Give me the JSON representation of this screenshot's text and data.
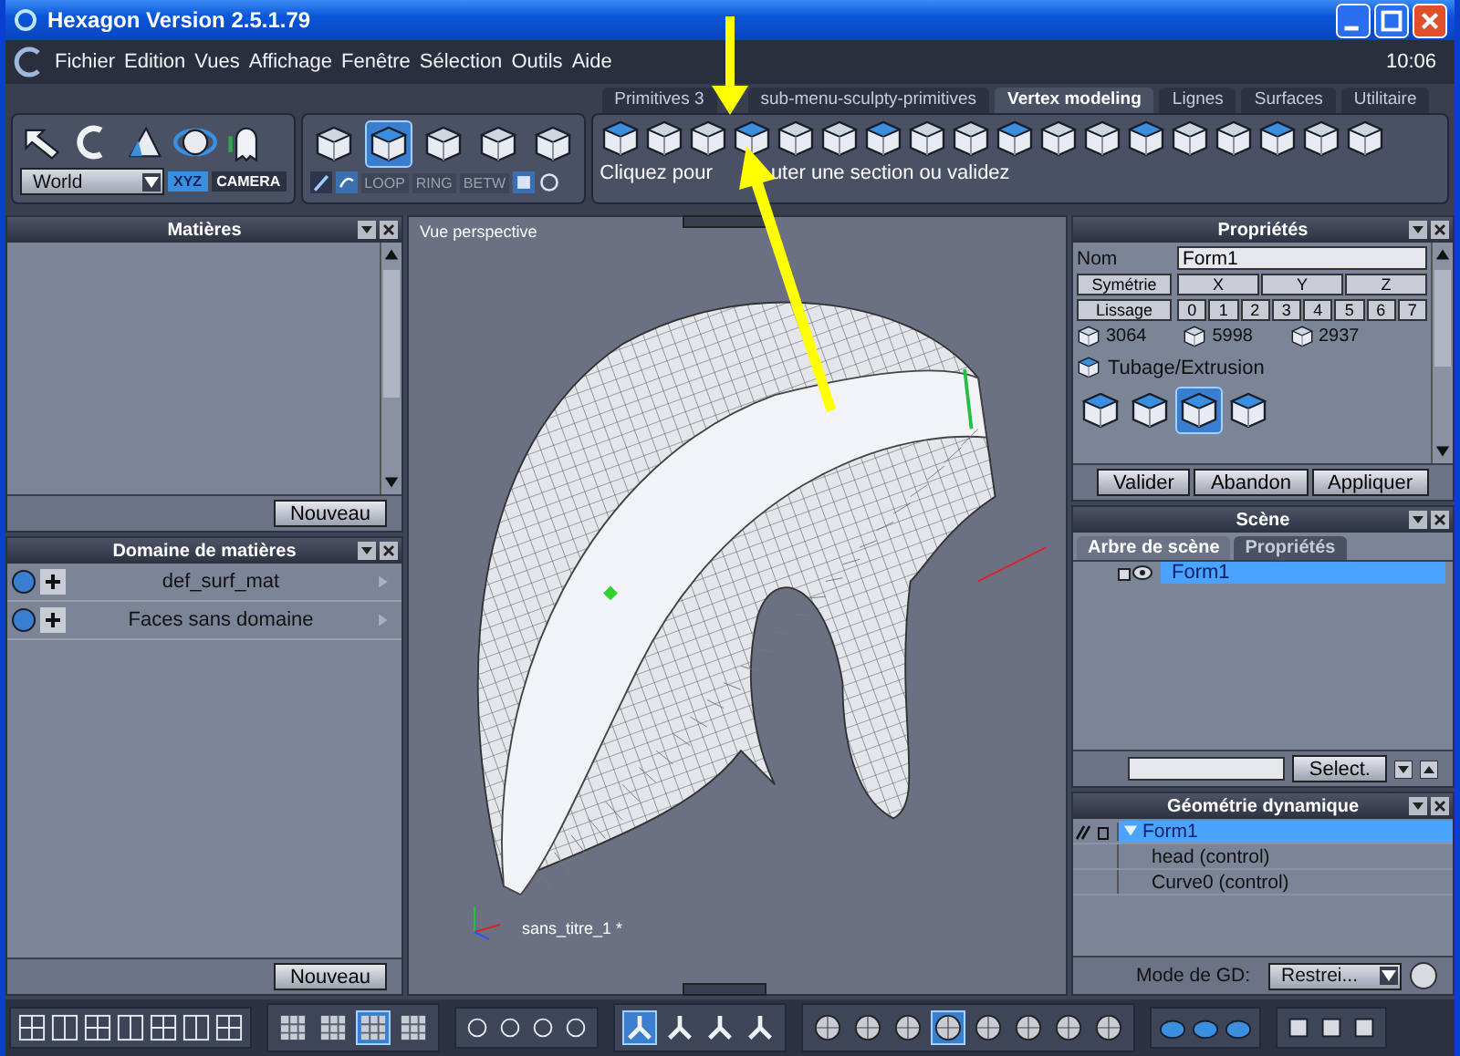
{
  "window": {
    "title": "Hexagon Version 2.5.1.79"
  },
  "menu": [
    "Fichier",
    "Edition",
    "Vues",
    "Affichage",
    "Fenêtre",
    "Sélection",
    "Outils",
    "Aide"
  ],
  "clock": "10:06",
  "coordinate_toolbar": {
    "space": "World",
    "toggles": [
      {
        "label": "XYZ",
        "selected": true
      },
      {
        "label": "CAMERA",
        "selected": false
      }
    ]
  },
  "selection_toolbar": {
    "modes": [
      {
        "selected": false
      },
      {
        "selected": true
      },
      {
        "selected": false
      },
      {
        "selected": false
      },
      {
        "selected": false
      }
    ],
    "options": [
      "LOOP",
      "RING",
      "BETW"
    ]
  },
  "tool_tabs": [
    {
      "label": "Primitives 3",
      "selected": false
    },
    {
      "label": "sub-menu-sculpty-primitives",
      "selected": false
    },
    {
      "label": "Vertex modeling",
      "selected": true
    },
    {
      "label": "Lignes",
      "selected": false
    },
    {
      "label": "Surfaces",
      "selected": false
    },
    {
      "label": "Utilitaire",
      "selected": false
    }
  ],
  "hint_parts": [
    "Cliquez pour",
    "uter une section ou validez"
  ],
  "materials_panel": {
    "title": "Matières",
    "button": "Nouveau"
  },
  "material_domains_panel": {
    "title": "Domaine de matières",
    "items": [
      "def_surf_mat",
      "Faces sans domaine"
    ],
    "button": "Nouveau"
  },
  "viewport": {
    "title": "Vue perspective",
    "document": "sans_titre_1 *"
  },
  "properties_panel": {
    "title": "Propriétés",
    "name_label": "Nom",
    "name_value": "Form1",
    "symmetry_button": "Symétrie",
    "axes": [
      "X",
      "Y",
      "Z"
    ],
    "smoothing_button": "Lissage",
    "levels": [
      "0",
      "1",
      "2",
      "3",
      "4",
      "5",
      "6",
      "7"
    ],
    "counts": [
      "3064",
      "5998",
      "2937"
    ],
    "tool": "Tubage/Extrusion",
    "tool_modes": [
      {
        "selected": false
      },
      {
        "selected": false
      },
      {
        "selected": true
      },
      {
        "selected": false
      }
    ],
    "buttons": [
      "Valider",
      "Abandon",
      "Appliquer"
    ]
  },
  "scene_panel": {
    "title": "Scène",
    "tabs": [
      {
        "label": "Arbre de scène",
        "selected": true
      },
      {
        "label": "Propriétés",
        "selected": false
      }
    ],
    "items": [
      {
        "label": "Form1",
        "selected": true
      }
    ],
    "select_button": "Select."
  },
  "dynamic_geometry_panel": {
    "title": "Géométrie dynamique",
    "tree": [
      {
        "label": "Form1",
        "selected": true,
        "expanded": true,
        "children": [
          {
            "label": "head (control)",
            "selected": false
          },
          {
            "label": "Curve0 (control)",
            "selected": false
          }
        ]
      }
    ],
    "mode_label": "Mode de GD:",
    "mode_value": "Restrei..."
  },
  "bottom_toolbar": {
    "display_modes": [
      {
        "selected": false
      },
      {
        "selected": false
      },
      {
        "selected": true
      },
      {
        "selected": false
      }
    ],
    "manipulators": [
      {
        "selected": true
      },
      {
        "selected": false
      },
      {
        "selected": false
      },
      {
        "selected": false
      }
    ],
    "shading_modes": [
      {
        "selected": false
      },
      {
        "selected": false
      },
      {
        "selected": false
      },
      {
        "selected": true
      },
      {
        "selected": false
      },
      {
        "selected": false
      },
      {
        "selected": false
      },
      {
        "selected": false
      }
    ]
  }
}
